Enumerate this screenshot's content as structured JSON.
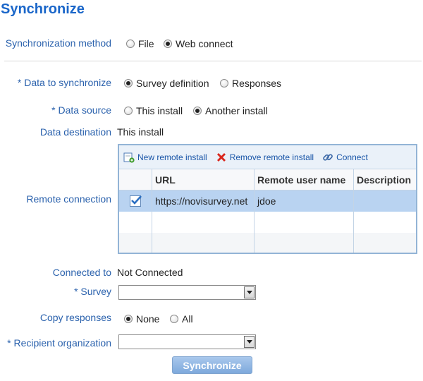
{
  "title": "Synchronize",
  "form": {
    "sync_method": {
      "label": "Synchronization method",
      "options": [
        "File",
        "Web connect"
      ],
      "selected": "Web connect"
    },
    "data_to_sync": {
      "label": "* Data to synchronize",
      "options": [
        "Survey definition",
        "Responses"
      ],
      "selected": "Survey definition"
    },
    "data_source": {
      "label": "* Data source",
      "options": [
        "This install",
        "Another install"
      ],
      "selected": "Another install"
    },
    "data_destination": {
      "label": "Data destination",
      "value": "This install"
    },
    "remote_connection": {
      "label": "Remote connection"
    },
    "connected_to": {
      "label": "Connected to",
      "value": "Not Connected"
    },
    "survey": {
      "label": "* Survey",
      "value": ""
    },
    "copy_responses": {
      "label": "Copy responses",
      "options": [
        "None",
        "All"
      ],
      "selected": "None"
    },
    "recipient_org": {
      "label": "* Recipient organization",
      "value": ""
    }
  },
  "grid": {
    "toolbar": {
      "new_remote": "New remote install",
      "remove_remote": "Remove remote install",
      "connect": "Connect"
    },
    "columns": [
      "",
      "URL",
      "Remote user name",
      "Description"
    ],
    "rows": [
      {
        "checked": true,
        "url": "https://novisurvey.net",
        "user": "jdoe",
        "description": ""
      }
    ]
  },
  "synchronize_button": "Synchronize",
  "colors": {
    "title": "#1a66c9",
    "label": "#2b62ad",
    "selected_row": "#b9d3f1",
    "button": "#8fb5e3"
  }
}
